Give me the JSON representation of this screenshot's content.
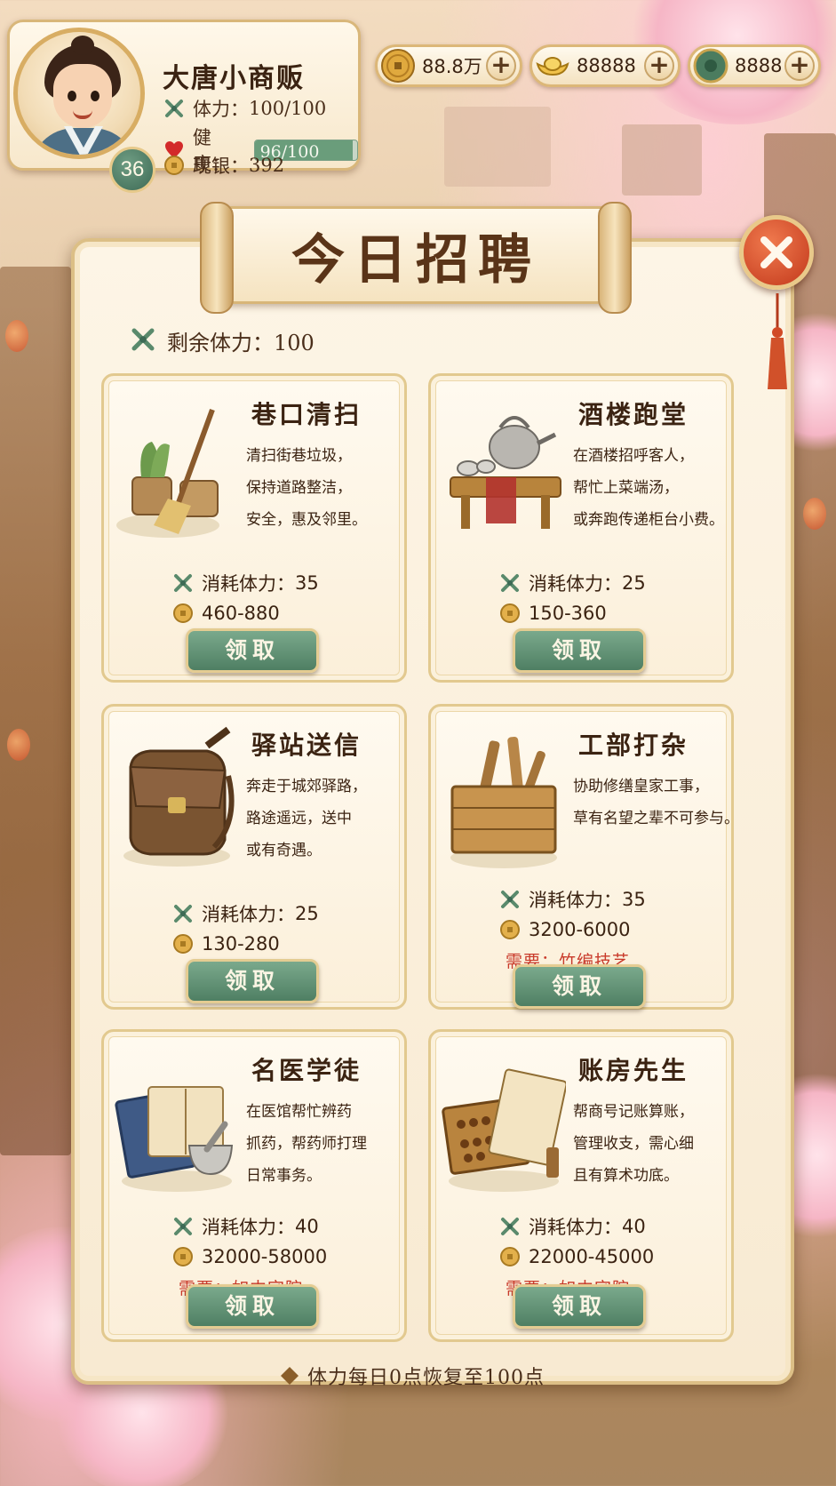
{
  "player": {
    "name": "大唐小商贩",
    "level": "36",
    "stamina_label": "体力：",
    "stamina_value": "100/100",
    "health_label": "健康：",
    "health_value": "96/100",
    "health_fraction": 0.96,
    "cash_label": "现银：",
    "cash_value": "392"
  },
  "currencies": [
    {
      "icon": "copper-coin-icon",
      "value": "88.8万"
    },
    {
      "icon": "gold-ingot-icon",
      "value": "88888"
    },
    {
      "icon": "jade-coin-icon",
      "value": "8888"
    }
  ],
  "panel": {
    "title": "今日招聘",
    "remaining_stamina": "剩余体力：100",
    "footer": "体力每日0点恢复至100点"
  },
  "jobs": [
    {
      "title": "巷口清扫",
      "desc": [
        "清扫街巷垃圾，",
        "保持道路整洁，",
        "安全，惠及邻里。"
      ],
      "cost_label": "消耗体力：",
      "cost_value": "35",
      "pay": "460-880",
      "requirement": "",
      "button": "领取",
      "illustration": "broom-bucket-icon"
    },
    {
      "title": "酒楼跑堂",
      "desc": [
        "在酒楼招呼客人，",
        "帮忙上菜端汤，",
        "或奔跑传递柜台小费。"
      ],
      "cost_label": "消耗体力：",
      "cost_value": "25",
      "pay": "150-360",
      "requirement": "",
      "button": "领取",
      "illustration": "teapot-table-icon"
    },
    {
      "title": "驿站送信",
      "desc": [
        "奔走于城郊驿路，",
        "路途遥远，送中",
        "或有奇遇。"
      ],
      "cost_label": "消耗体力：",
      "cost_value": "25",
      "pay": "130-280",
      "requirement": "",
      "button": "领取",
      "illustration": "messenger-bag-icon"
    },
    {
      "title": "工部打杂",
      "desc": [
        "协助修缮皇家工事，",
        "草有名望之辈不可参与。"
      ],
      "cost_label": "消耗体力：",
      "cost_value": "35",
      "pay": "3200-6000",
      "requirement": "需要：竹编技艺",
      "button": "领取",
      "illustration": "tool-crate-icon"
    },
    {
      "title": "名医学徒",
      "desc": [
        "在医馆帮忙辨药",
        "抓药，帮药师打理",
        "日常事务。"
      ],
      "cost_label": "消耗体力：",
      "cost_value": "40",
      "pay": "32000-58000",
      "requirement": "需要：如中宅院",
      "button": "领取",
      "illustration": "medicine-book-mortar-icon"
    },
    {
      "title": "账房先生",
      "desc": [
        "帮商号记账算账，",
        "管理收支，需心细",
        "且有算术功底。"
      ],
      "cost_label": "消耗体力：",
      "cost_value": "40",
      "pay": "22000-45000",
      "requirement": "需要：如中宅院",
      "button": "领取",
      "illustration": "abacus-ledger-icon"
    }
  ],
  "colors": {
    "accent_green": "#5a8a6c",
    "requirement_red": "#c93a2a",
    "panel_bg": "#fbf0dc",
    "close_red": "#d2482a"
  }
}
